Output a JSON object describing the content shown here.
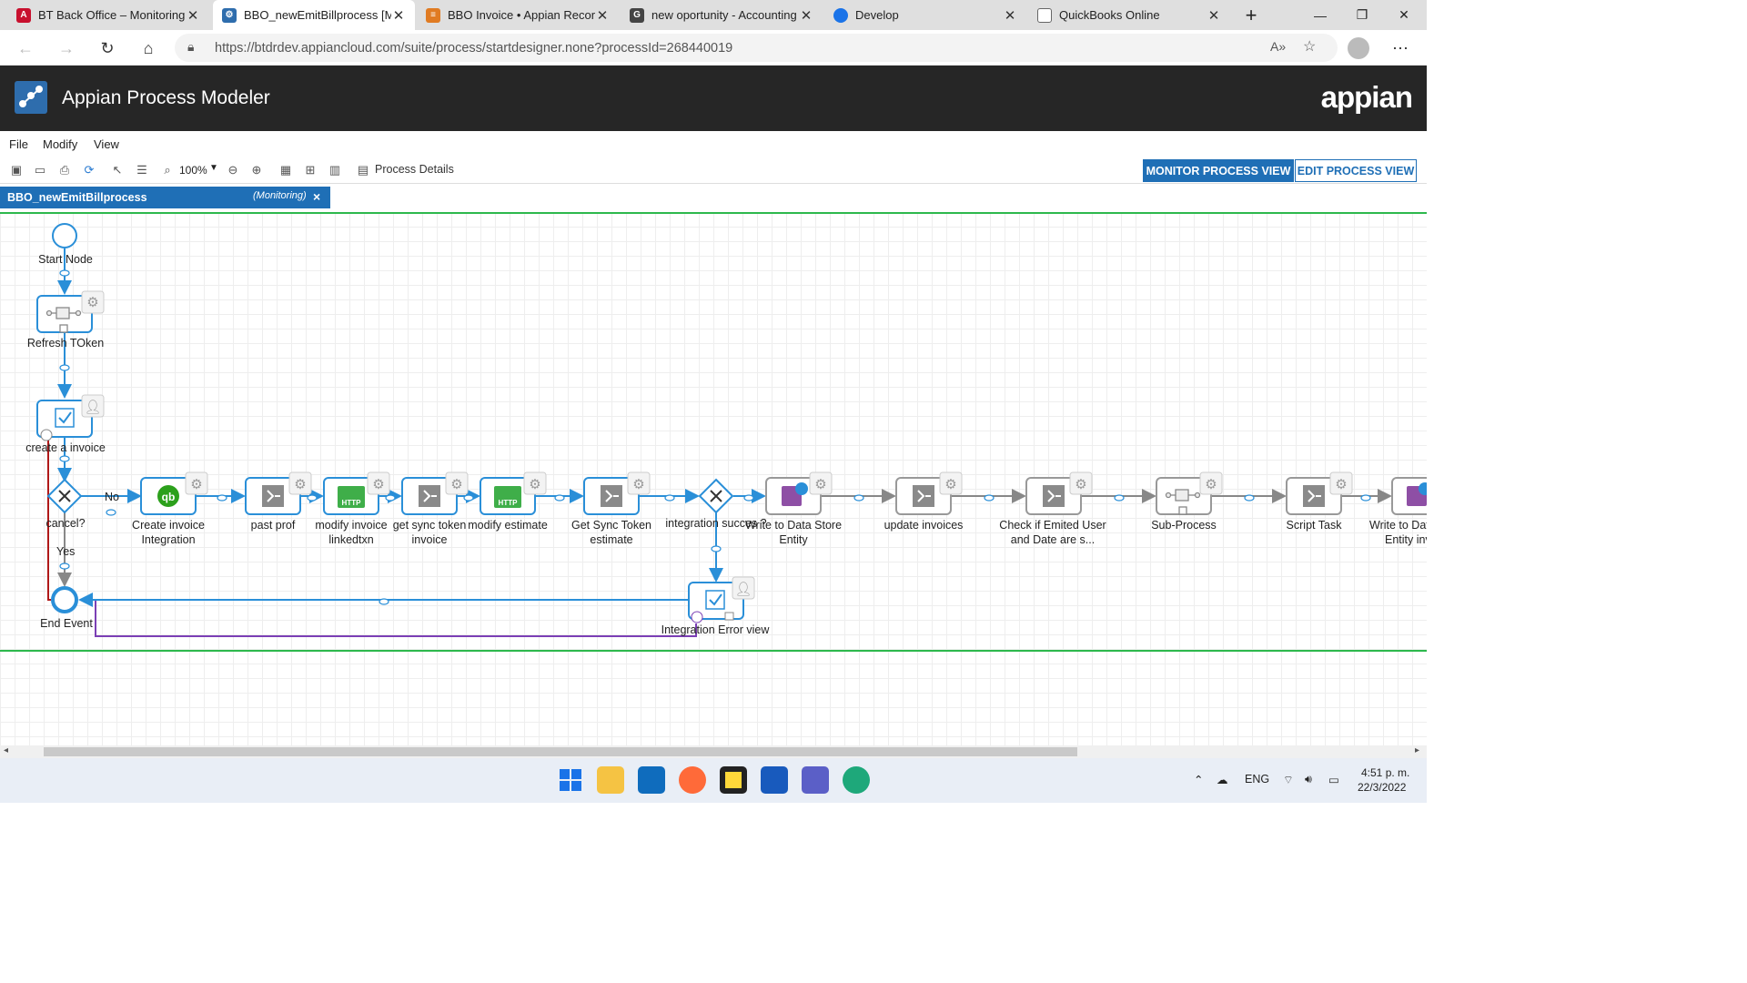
{
  "browser": {
    "tabs": [
      {
        "title": "BT Back Office – Monitoring ·",
        "favicon": "A",
        "favicon_color": "#c8102e",
        "active": false
      },
      {
        "title": "BBO_newEmitBillprocess [Mo",
        "favicon": "appian",
        "favicon_color": "#2e6dad",
        "active": true
      },
      {
        "title": "BBO Invoice • Appian Record",
        "favicon": "record",
        "favicon_color": "#e07b22",
        "active": false
      },
      {
        "title": "new oportunity - Accounting",
        "favicon": "G",
        "favicon_color": "#444444",
        "active": false
      },
      {
        "title": "Develop",
        "favicon": "edge",
        "favicon_color": "#1a73e8",
        "active": false
      },
      {
        "title": "QuickBooks Online",
        "favicon": "page",
        "favicon_color": "#666666",
        "active": false
      }
    ],
    "url": "https://btdrdev.appiancloud.com/suite/process/startdesigner.none?processId=268440019"
  },
  "app": {
    "title": "Appian Process Modeler",
    "brand": "appian"
  },
  "menus": [
    "File",
    "Modify",
    "View"
  ],
  "toolbar": {
    "zoom": "100%",
    "process_details": "Process Details",
    "monitor_view": "MONITOR PROCESS VIEW",
    "edit_view": "EDIT PROCESS VIEW"
  },
  "diagram_tab": {
    "name": "BBO_newEmitBillprocess",
    "mode": "(Monitoring)",
    "close": "×"
  },
  "nodes": {
    "start": "Start Node",
    "refresh": "Refresh TOken",
    "create": "create a invoice",
    "cancel": "cancel?",
    "no": "No",
    "yes": "Yes",
    "end": "End Event",
    "qb_line1": "Create invoice",
    "qb_line2": "Integration",
    "past": "past prof",
    "modify_line1": "modify invoice",
    "modify_line2": "linkedtxn",
    "sync_line1": "get sync token",
    "sync_line2": "invoice",
    "modest": "modify estimate",
    "gst_line1": "Get Sync Token",
    "gst_line2": "estimate",
    "success": "integration succes ?",
    "write1_line1": "Write to Data Store",
    "write1_line2": "Entity",
    "update": "update invoices",
    "check_line1": "Check if Emited User",
    "check_line2": "and Date are s...",
    "subprocess": "Sub-Process",
    "script": "Script Task",
    "write2_line1": "Write to Dat",
    "write2_line2": "Entity inv",
    "error": "Integration Error view",
    "http": "HTTP"
  },
  "colors": {
    "header_bg": "#262626",
    "accent": "#1f6fb6",
    "flow": "#2a8fd8",
    "green_boundary": "#2db84d",
    "cancel_path": "#b01818",
    "error_path": "#7b3fb5"
  },
  "taskbar": {
    "lang": "ENG",
    "time": "4:51 p. m.",
    "date": "22/3/2022"
  }
}
